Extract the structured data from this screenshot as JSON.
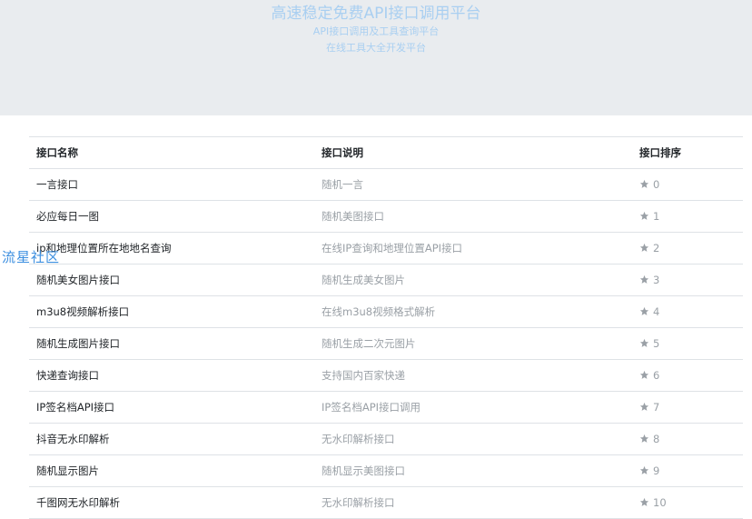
{
  "hero": {
    "title": "高速稳定免费API接口调用平台",
    "subtitle1": "API接口调用及工具查询平台",
    "subtitle2": "在线工具大全开发平台"
  },
  "watermark": "流星社区",
  "table": {
    "headers": {
      "name": "接口名称",
      "desc": "接口说明",
      "rank": "接口排序"
    },
    "rows": [
      {
        "name": "一言接口",
        "desc": "随机一言",
        "rank": "0"
      },
      {
        "name": "必应每日一图",
        "desc": "随机美图接口",
        "rank": "1"
      },
      {
        "name": "ip和地理位置所在地地名查询",
        "desc": "在线IP查询和地理位置API接口",
        "rank": "2"
      },
      {
        "name": "随机美女图片接口",
        "desc": "随机生成美女图片",
        "rank": "3"
      },
      {
        "name": "m3u8视频解析接口",
        "desc": "在线m3u8视频格式解析",
        "rank": "4"
      },
      {
        "name": "随机生成图片接口",
        "desc": "随机生成二次元图片",
        "rank": "5"
      },
      {
        "name": "快递查询接口",
        "desc": "支持国内百家快递",
        "rank": "6"
      },
      {
        "name": "IP签名档API接口",
        "desc": "IP签名档API接口调用",
        "rank": "7"
      },
      {
        "name": "抖音无水印解析",
        "desc": "无水印解析接口",
        "rank": "8"
      },
      {
        "name": "随机显示图片",
        "desc": "随机显示美图接口",
        "rank": "9"
      },
      {
        "name": "千图网无水印解析",
        "desc": "无水印解析接口",
        "rank": "10"
      }
    ]
  },
  "colors": {
    "hero_bg": "#e9ecef",
    "hero_text": "#a9cff1",
    "watermark": "#3c8fe0",
    "star": "#9aa0a6"
  }
}
